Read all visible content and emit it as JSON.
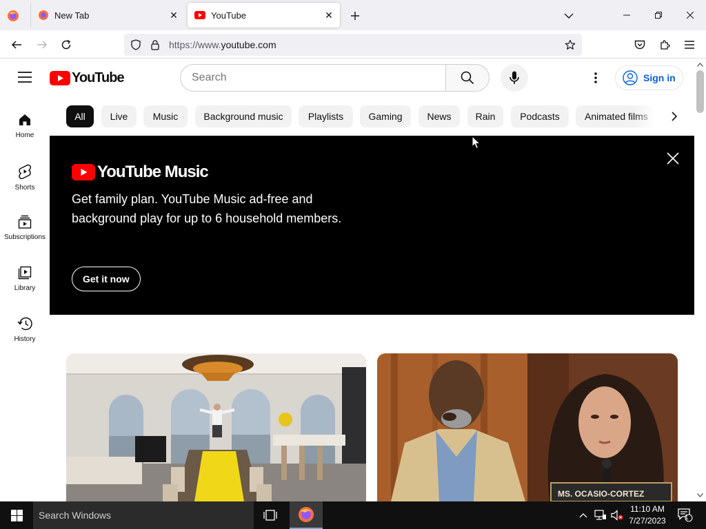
{
  "browser": {
    "tabs": [
      {
        "title": "New Tab",
        "active": false
      },
      {
        "title": "YouTube",
        "active": true
      }
    ],
    "url": {
      "prefix": "https://www.",
      "host": "youtube.com"
    }
  },
  "masthead": {
    "logo_text": "YouTube",
    "search_placeholder": "Search",
    "sign_in_label": "Sign in"
  },
  "guide": {
    "items": [
      {
        "label": "Home",
        "icon": "home-icon"
      },
      {
        "label": "Shorts",
        "icon": "shorts-icon"
      },
      {
        "label": "Subscriptions",
        "icon": "subscriptions-icon"
      },
      {
        "label": "Library",
        "icon": "library-icon"
      },
      {
        "label": "History",
        "icon": "history-icon"
      }
    ]
  },
  "chips": [
    "All",
    "Live",
    "Music",
    "Background music",
    "Playlists",
    "Gaming",
    "News",
    "Rain",
    "Podcasts",
    "Animated films"
  ],
  "banner": {
    "logo_text": "YouTube Music",
    "text": "Get family plan. YouTube Music ad-free and background play for up to 6 household members.",
    "cta": "Get it now"
  },
  "videos": [
    {
      "thumbnail": "penthouse-dining-room"
    },
    {
      "thumbnail": "hearing-split-screen",
      "caption": "MS. OCASIO-CORTEZ"
    }
  ],
  "taskbar": {
    "search_placeholder": "Search Windows",
    "time": "11:10 AM",
    "date": "7/27/2023",
    "notification_count": "1"
  },
  "colors": {
    "youtube_red": "#ff0000",
    "link_blue": "#065fd4",
    "chip_bg": "#f2f2f2",
    "chip_selected_bg": "#0f0f0f",
    "banner_bg": "#000000",
    "taskbar_bg": "#101010"
  }
}
